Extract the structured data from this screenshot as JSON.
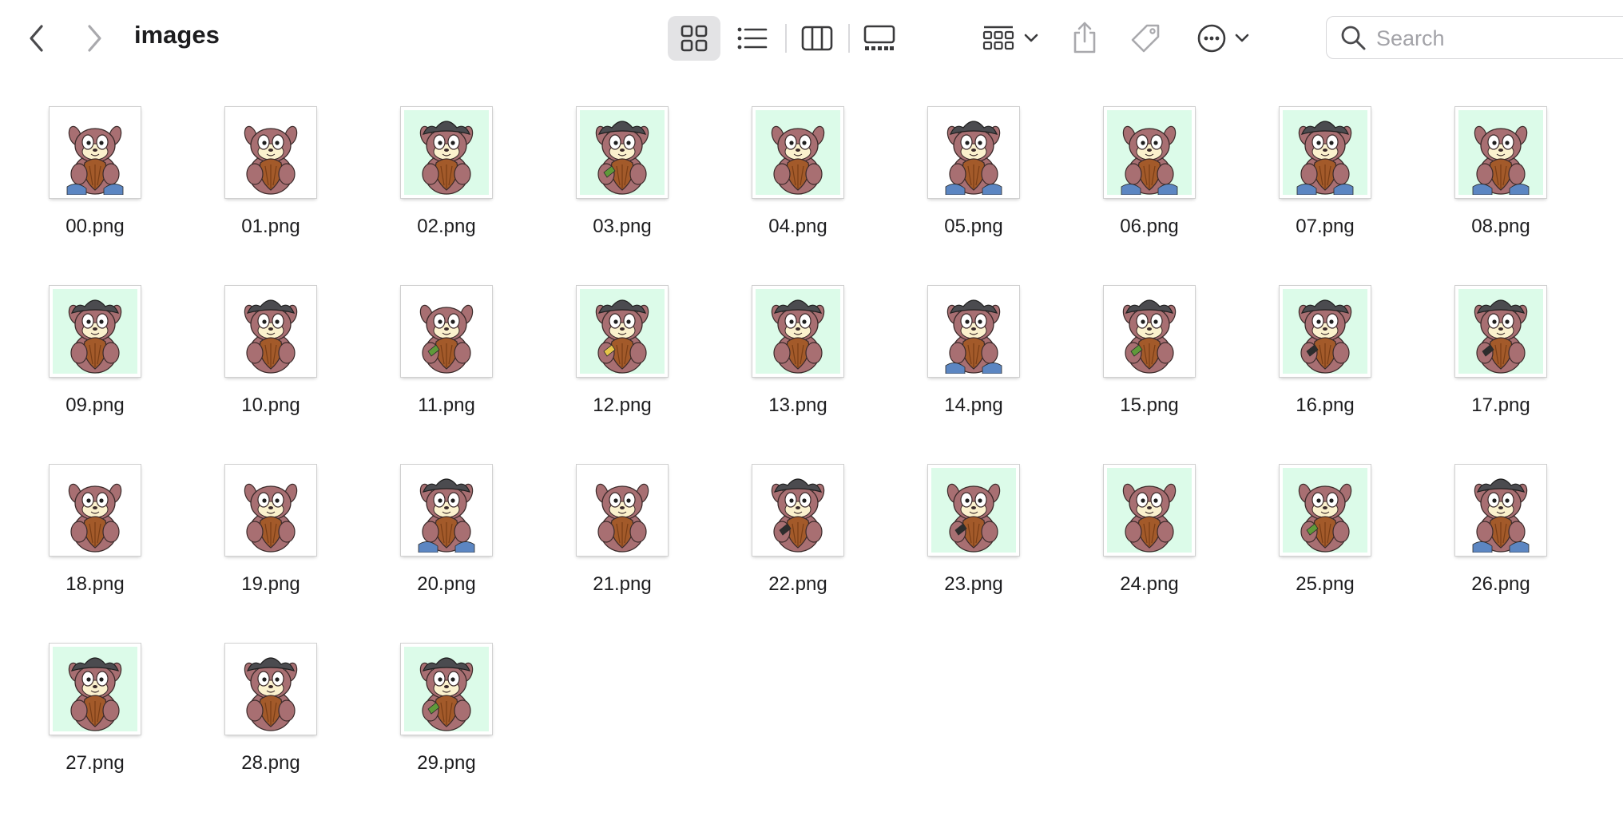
{
  "window": {
    "title": "images"
  },
  "toolbar": {
    "back_icon": "chevron-left-icon",
    "forward_icon": "chevron-right-icon",
    "view_modes": [
      {
        "name": "icon-view",
        "icon": "grid-icon",
        "active": true
      },
      {
        "name": "list-view",
        "icon": "list-icon",
        "active": false
      },
      {
        "name": "column-view",
        "icon": "columns-icon",
        "active": false
      },
      {
        "name": "gallery-view",
        "icon": "gallery-icon",
        "active": false
      }
    ],
    "group_icon": "group-icon",
    "share_icon": "share-icon",
    "tag_icon": "tag-icon",
    "more_icon": "ellipsis-circle-icon"
  },
  "search": {
    "placeholder": "Search",
    "value": ""
  },
  "colors": {
    "thumb_white": "#ffffff",
    "thumb_mint": "#dcfbe9",
    "fur": "#a86f72",
    "acorn": "#a35a2a",
    "hat": "#4b4b4f",
    "eye_patch": "#fbf1cd",
    "shirt": "#5c86c2"
  },
  "files": [
    {
      "name": "00.png",
      "bg": "white",
      "hat": false,
      "accessory": "blue"
    },
    {
      "name": "01.png",
      "bg": "white",
      "hat": false,
      "accessory": "none"
    },
    {
      "name": "02.png",
      "bg": "mint",
      "hat": true,
      "accessory": "none"
    },
    {
      "name": "03.png",
      "bg": "mint",
      "hat": true,
      "accessory": "green"
    },
    {
      "name": "04.png",
      "bg": "mint",
      "hat": false,
      "accessory": "none"
    },
    {
      "name": "05.png",
      "bg": "white",
      "hat": true,
      "accessory": "blue"
    },
    {
      "name": "06.png",
      "bg": "mint",
      "hat": false,
      "accessory": "blue"
    },
    {
      "name": "07.png",
      "bg": "mint",
      "hat": true,
      "accessory": "blue"
    },
    {
      "name": "08.png",
      "bg": "mint",
      "hat": false,
      "accessory": "blue"
    },
    {
      "name": "09.png",
      "bg": "mint",
      "hat": true,
      "accessory": "none"
    },
    {
      "name": "10.png",
      "bg": "white",
      "hat": true,
      "accessory": "none"
    },
    {
      "name": "11.png",
      "bg": "white",
      "hat": false,
      "accessory": "green"
    },
    {
      "name": "12.png",
      "bg": "mint",
      "hat": true,
      "accessory": "yellow"
    },
    {
      "name": "13.png",
      "bg": "mint",
      "hat": true,
      "accessory": "none"
    },
    {
      "name": "14.png",
      "bg": "white",
      "hat": true,
      "accessory": "blue"
    },
    {
      "name": "15.png",
      "bg": "white",
      "hat": true,
      "accessory": "green"
    },
    {
      "name": "16.png",
      "bg": "mint",
      "hat": true,
      "accessory": "black"
    },
    {
      "name": "17.png",
      "bg": "mint",
      "hat": true,
      "accessory": "black"
    },
    {
      "name": "18.png",
      "bg": "white",
      "hat": false,
      "accessory": "none"
    },
    {
      "name": "19.png",
      "bg": "white",
      "hat": false,
      "accessory": "none"
    },
    {
      "name": "20.png",
      "bg": "white",
      "hat": true,
      "accessory": "blue"
    },
    {
      "name": "21.png",
      "bg": "white",
      "hat": false,
      "accessory": "none"
    },
    {
      "name": "22.png",
      "bg": "white",
      "hat": true,
      "accessory": "black"
    },
    {
      "name": "23.png",
      "bg": "mint",
      "hat": false,
      "accessory": "black"
    },
    {
      "name": "24.png",
      "bg": "mint",
      "hat": false,
      "accessory": "none"
    },
    {
      "name": "25.png",
      "bg": "mint",
      "hat": false,
      "accessory": "green"
    },
    {
      "name": "26.png",
      "bg": "white",
      "hat": true,
      "accessory": "blue"
    },
    {
      "name": "27.png",
      "bg": "mint",
      "hat": true,
      "accessory": "none"
    },
    {
      "name": "28.png",
      "bg": "white",
      "hat": true,
      "accessory": "none"
    },
    {
      "name": "29.png",
      "bg": "mint",
      "hat": true,
      "accessory": "green"
    }
  ]
}
